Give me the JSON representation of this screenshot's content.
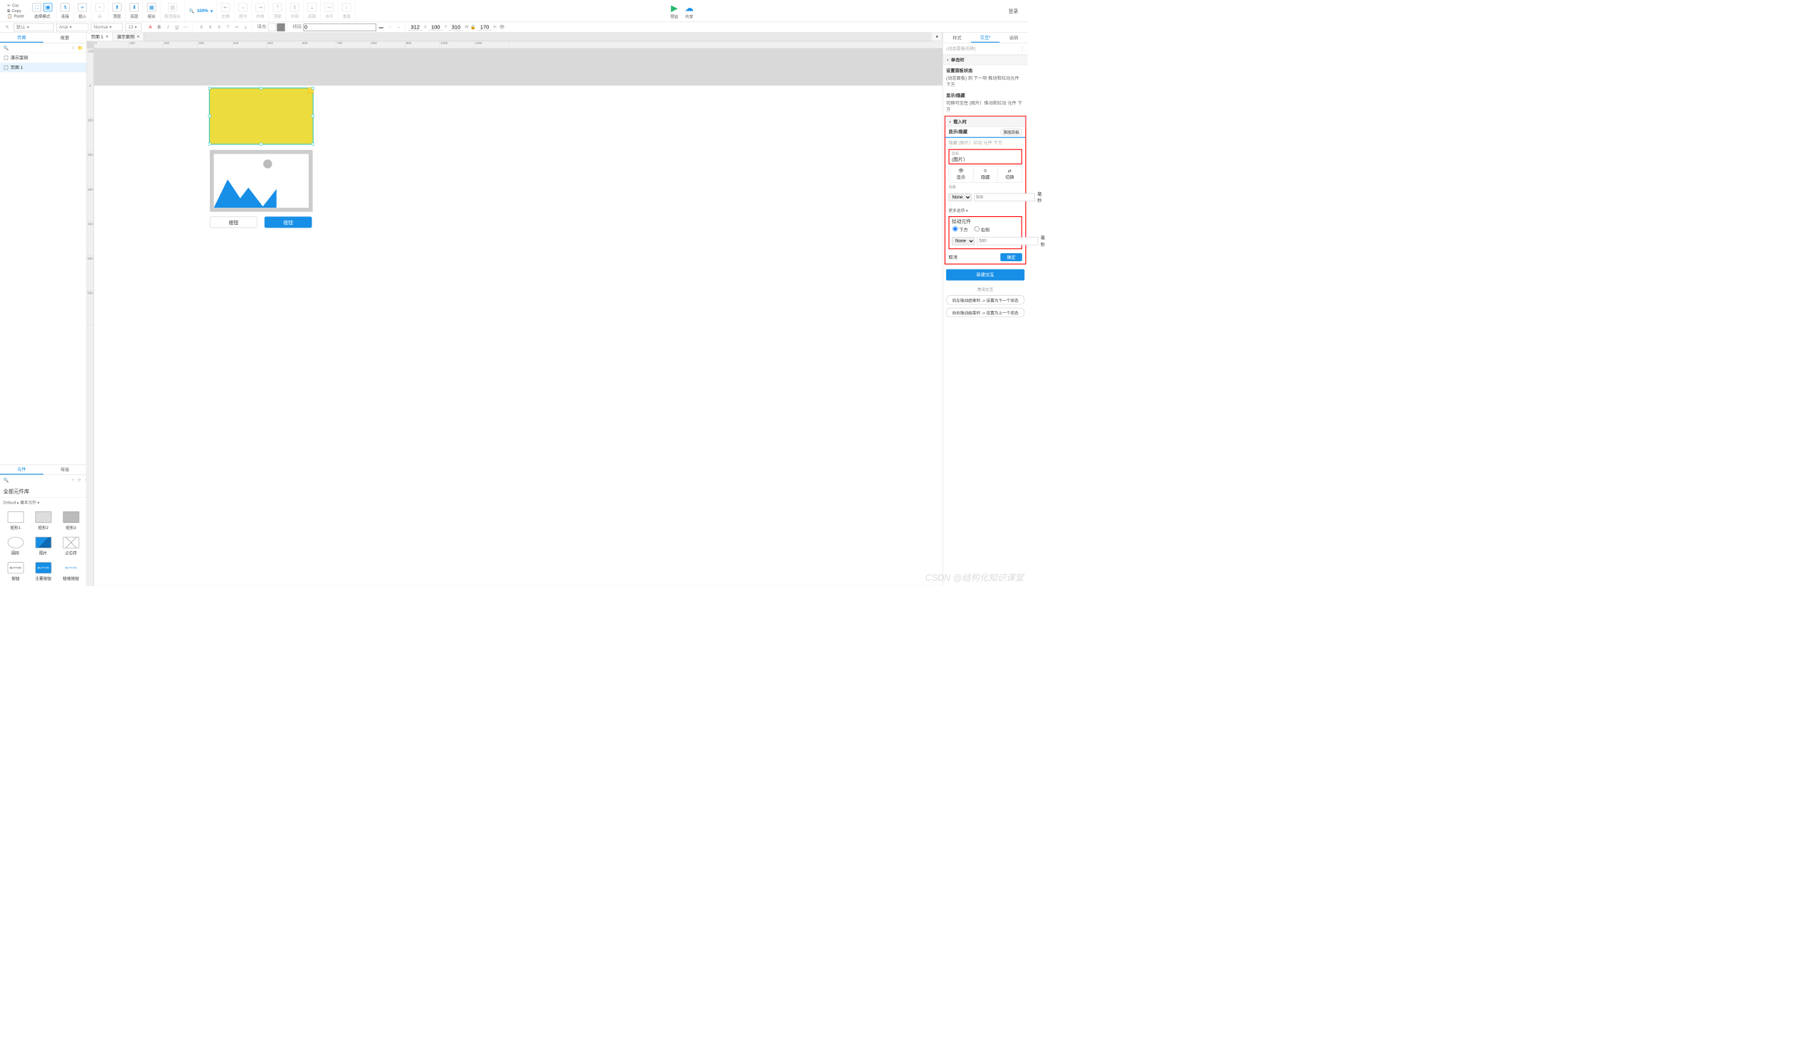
{
  "clip": {
    "cut": "Cut",
    "copy": "Copy",
    "paste": "Paste"
  },
  "ribbon": {
    "select_mode": "选择模式",
    "connect": "连接",
    "insert": "插入",
    "dot": "点",
    "front": "顶层",
    "back": "底层",
    "group": "组合",
    "ungroup": "取消组合",
    "zoom": "100%",
    "align": {
      "left": "左侧",
      "center": "居中",
      "right": "右侧",
      "top": "顶部",
      "middle": "中部",
      "bottom": "底部",
      "dh": "水平",
      "dv": "垂直"
    },
    "preview": "预览",
    "share": "共享",
    "login": "登录"
  },
  "tb2": {
    "styleName": "默认",
    "font": "Arial",
    "fontWeight": "Normal",
    "fontSize": "13",
    "fill": "填充:",
    "stroke": "线段:",
    "strokeW": "0",
    "x": "312",
    "xl": "X",
    "y": "100",
    "yl": "Y",
    "w": "310",
    "wl": "W",
    "h": "170",
    "hl": "H",
    "lock": "🔒"
  },
  "pages": {
    "tab_page": "页面",
    "tab_outline": "概要",
    "items": [
      "演示案例",
      "页面 1"
    ],
    "search_ph": "搜索"
  },
  "libs": {
    "tab_widgets": "元件",
    "tab_masters": "母版",
    "lib": "全部元件库",
    "sub": "Default ▸ 基本元件 ▾",
    "widgets": [
      {
        "name": "矩形1"
      },
      {
        "name": "矩形2"
      },
      {
        "name": "矩形3"
      },
      {
        "name": "圆形"
      },
      {
        "name": "图片"
      },
      {
        "name": "占位符"
      },
      {
        "name": "按钮",
        "txt": "BUTTON"
      },
      {
        "name": "主要按钮",
        "txt": "BUTTON"
      },
      {
        "name": "链接按钮",
        "txt": "BUTTON"
      }
    ]
  },
  "tabs": [
    {
      "label": "页面 1",
      "active": true
    },
    {
      "label": "演示案例",
      "active": false
    }
  ],
  "canvas": {
    "btn1": "按钮",
    "btn2": "按钮"
  },
  "rsb": {
    "tabs": {
      "style": "样式",
      "interact": "交互",
      "note": "说明"
    },
    "name_ph": "(动态面板名称)",
    "click": {
      "title": "单击时",
      "a1t": "设置面板状态",
      "a1d": "(动态面板) 到 下一项 推动和拉动元件 下方",
      "a2t": "显示/隐藏",
      "a2d": "切换可见性 (图片）推动和拉动 元件 下方"
    },
    "load": {
      "title": "载入时",
      "prop": "显示/隐藏",
      "addTarget": "添加目标",
      "summary": "隐藏 (图片）拉动 元件 下方",
      "target_lbl": "目标",
      "target_val": "(图片）",
      "vis": {
        "show": "显示",
        "hide": "隐藏",
        "toggle": "切换"
      },
      "anim_lbl": "动画",
      "anim_val": "None",
      "anim_ms": "500",
      "ms": "毫秒",
      "more": "更多选项 ▾",
      "pull": "拉动元件",
      "dir": {
        "below": "下方",
        "right": "右侧"
      },
      "anim2_val": "None",
      "anim2_ms": "500",
      "ms2": "毫秒",
      "cancel": "取消",
      "ok": "确定"
    },
    "newint": "新建交互",
    "common_lbl": "常用交互",
    "chips": [
      "向左拖动结束时 -> 设置为下一个状态",
      "向右拖动结束时 -> 设置为上一个状态"
    ]
  },
  "watermark": "CSDN @结构化知识课堂",
  "hruler": [
    "0",
    "100",
    "200",
    "300",
    "400",
    "500",
    "600",
    "700",
    "800",
    "900",
    "1000",
    "1100"
  ],
  "vruler": [
    "-100",
    "0",
    "100",
    "200",
    "300",
    "400",
    "500",
    "600"
  ]
}
